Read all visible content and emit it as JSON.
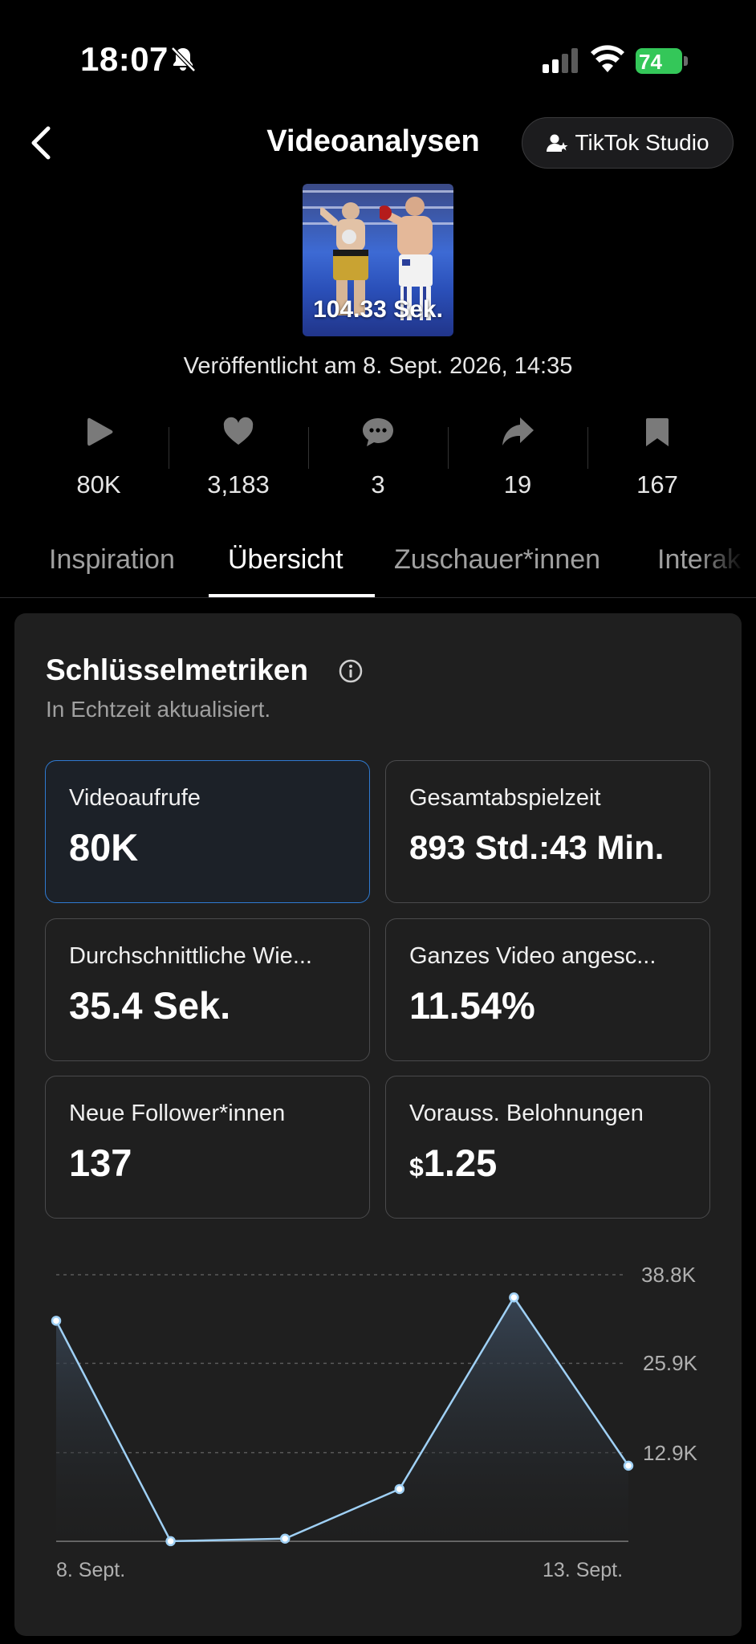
{
  "status_bar": {
    "time": "18:07",
    "battery_level": "74",
    "icons": [
      "bell-slash-icon",
      "signal-icon",
      "wifi-icon",
      "battery-charging-icon"
    ]
  },
  "header": {
    "title": "Videoanalysen",
    "back_icon": "chevron-left-icon",
    "studio_button": "TikTok Studio",
    "studio_icon": "user-star-icon"
  },
  "video": {
    "duration": "104.33 Sek.",
    "published": "Veröffentlicht am 8. Sept. 2026, 14:35"
  },
  "stats": [
    {
      "icon": "play-icon",
      "value": "80K"
    },
    {
      "icon": "heart-icon",
      "value": "3,183"
    },
    {
      "icon": "comment-icon",
      "value": "3"
    },
    {
      "icon": "share-icon",
      "value": "19"
    },
    {
      "icon": "bookmark-icon",
      "value": "167"
    }
  ],
  "tabs": [
    {
      "label": "Inspiration",
      "active": false
    },
    {
      "label": "Übersicht",
      "active": true
    },
    {
      "label": "Zuschauer*innen",
      "active": false
    },
    {
      "label": "Interak",
      "active": false
    }
  ],
  "key_metrics": {
    "title": "Schlüsselmetriken",
    "subtitle": "In Echtzeit aktualisiert.",
    "items": [
      {
        "label": "Videoaufrufe",
        "value": "80K",
        "selected": true
      },
      {
        "label": "Gesamtabspielzeit",
        "value": "893 Std.:43 Min.",
        "selected": false
      },
      {
        "label": "Durchschnittliche Wie...",
        "value": "35.4 Sek.",
        "selected": false
      },
      {
        "label": "Ganzes Video angesc...",
        "value": "11.54%",
        "selected": false
      },
      {
        "label": "Neue Follower*innen",
        "value": "137",
        "selected": false
      },
      {
        "label": "Vorauss. Belohnungen",
        "currency": "$",
        "value": "1.25",
        "selected": false
      }
    ]
  },
  "chart_data": {
    "type": "area",
    "x": [
      "8. Sept.",
      "9. Sept.",
      "10. Sept.",
      "11. Sept.",
      "12. Sept.",
      "13. Sept."
    ],
    "series": [
      {
        "values": [
          32100,
          9,
          380,
          7600,
          35500,
          11000
        ]
      }
    ],
    "y_ticks": [
      "38.8K",
      "25.9K",
      "12.9K"
    ],
    "y_tick_values": [
      38800,
      25900,
      12900
    ],
    "x_tick_labels": [
      "8. Sept.",
      "13. Sept."
    ],
    "ylim": [
      0,
      38800
    ],
    "grid": true,
    "line_color": "#9fd0f5",
    "title": "",
    "xlabel": "",
    "ylabel": ""
  },
  "colors": {
    "accent_selected_border": "#2f7ad1",
    "battery": "#34c759",
    "card_bg": "#1f1f1f"
  }
}
